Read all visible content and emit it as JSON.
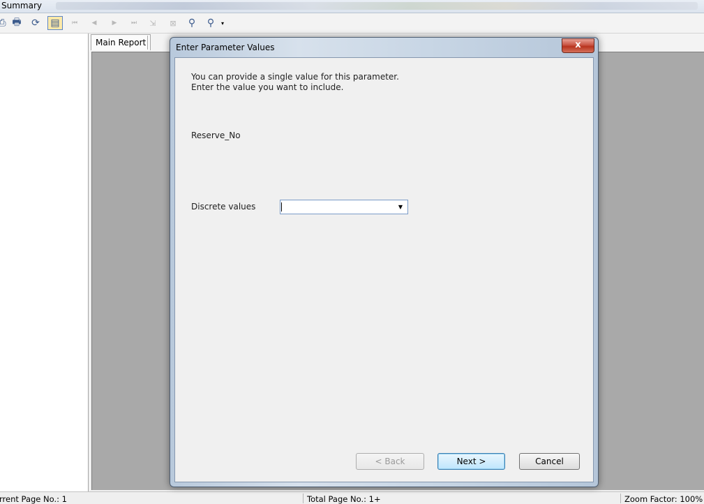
{
  "window": {
    "title": "Summary"
  },
  "toolbar": {
    "buttons": [
      {
        "icon": "export-icon",
        "glyph": "⎙",
        "enabled": true
      },
      {
        "icon": "print-icon",
        "glyph": "🖶",
        "enabled": true
      },
      {
        "icon": "refresh-icon",
        "glyph": "⟳",
        "enabled": true
      },
      {
        "icon": "toggle-group-tree-icon",
        "glyph": "▤",
        "enabled": true
      },
      {
        "icon": "first-page-icon",
        "glyph": "⏮",
        "enabled": false
      },
      {
        "icon": "previous-page-icon",
        "glyph": "◀",
        "enabled": false
      },
      {
        "icon": "next-page-icon",
        "glyph": "▶",
        "enabled": false
      },
      {
        "icon": "last-page-icon",
        "glyph": "⏭",
        "enabled": false
      },
      {
        "icon": "go-to-page-icon",
        "glyph": "⇲",
        "enabled": false
      },
      {
        "icon": "stop-icon",
        "glyph": "⊠",
        "enabled": false
      },
      {
        "icon": "search-icon",
        "glyph": "⚲",
        "enabled": true
      },
      {
        "icon": "zoom-icon",
        "glyph": "⚲",
        "enabled": true
      }
    ]
  },
  "report": {
    "tab_label": "Main Report"
  },
  "status": {
    "current_page": "rrent Page No.: 1",
    "total_pages": "Total Page No.: 1+",
    "zoom": "Zoom Factor: 100%"
  },
  "dialog": {
    "title": "Enter Parameter Values",
    "close_label": "x",
    "intro_line1": "You can provide a single value for this parameter.",
    "intro_line2": "Enter the value you want to include.",
    "parameter_name": "Reserve_No",
    "discrete_label": "Discrete values",
    "discrete_value": "",
    "back_label": "< Back",
    "next_label": "Next >",
    "cancel_label": "Cancel"
  }
}
